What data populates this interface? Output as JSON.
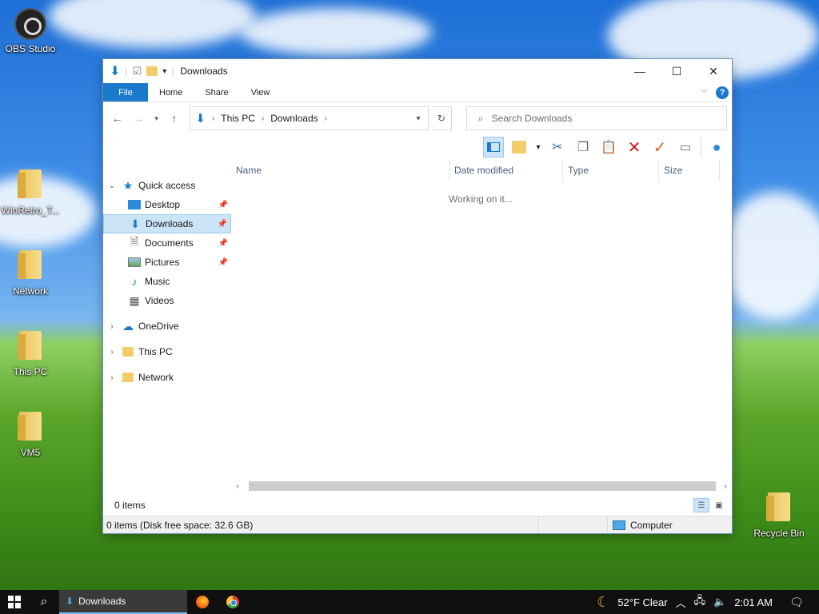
{
  "desktop": {
    "icons": [
      {
        "label": "OBS Studio",
        "icon": "obs-icon"
      },
      {
        "label": "WinRetro_T...",
        "icon": "file-folder-icon"
      },
      {
        "label": "Network",
        "icon": "folder-icon"
      },
      {
        "label": "This PC",
        "icon": "folder-icon"
      },
      {
        "label": "VM5",
        "icon": "folder-icon"
      },
      {
        "label": "Recycle Bin",
        "icon": "folder-icon"
      }
    ]
  },
  "window": {
    "title": "Downloads",
    "controls": {
      "minimize": "—",
      "maximize": "☐",
      "close": "✕"
    },
    "ribbon_tabs": [
      "File",
      "Home",
      "Share",
      "View"
    ],
    "help": "?",
    "address": {
      "crumbs": [
        "This PC",
        "Downloads"
      ]
    },
    "search_placeholder": "Search Downloads",
    "nav_pane": {
      "quick_access": "Quick access",
      "quick_items": [
        "Desktop",
        "Downloads",
        "Documents",
        "Pictures",
        "Music",
        "Videos"
      ],
      "roots": [
        "OneDrive",
        "This PC",
        "Network"
      ],
      "selected": "Downloads"
    },
    "columns": [
      "Name",
      "Date modified",
      "Type",
      "Size"
    ],
    "working_text": "Working on it...",
    "status_items": "0 items",
    "status_detail": "0 items (Disk free space: 32.6 GB)",
    "status_location": "Computer"
  },
  "taskbar": {
    "active_app": "Downloads",
    "weather": "52°F  Clear",
    "time": "2:01 AM"
  },
  "colors": {
    "accent": "#1979ca",
    "selection": "#cce4f7",
    "taskbar": "#101010"
  }
}
